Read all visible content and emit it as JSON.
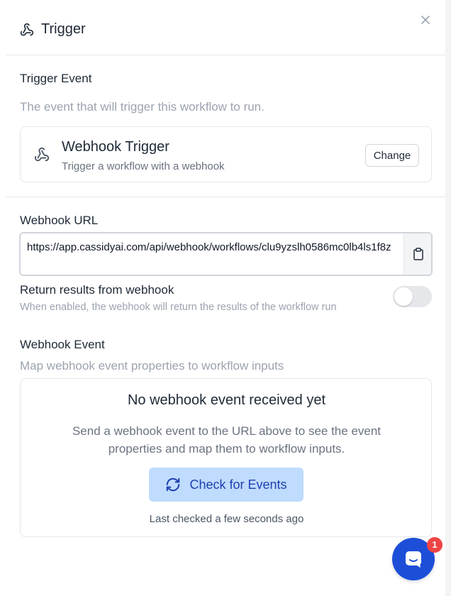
{
  "header": {
    "title": "Trigger",
    "icon": "webhook-icon",
    "close_icon": "close-icon"
  },
  "trigger_event": {
    "label": "Trigger Event",
    "description": "The event that will trigger this workflow to run.",
    "card": {
      "icon": "webhook-icon",
      "title": "Webhook Trigger",
      "subtitle": "Trigger a workflow with a webhook",
      "change_label": "Change"
    }
  },
  "webhook_url": {
    "label": "Webhook URL",
    "value": "https://app.cassidyai.com/api/webhook/workflows/clu9yzslh0586mc0lb4ls1f8z",
    "copy_icon": "clipboard-icon"
  },
  "return_results": {
    "label": "Return results from webhook",
    "description": "When enabled, the webhook will return the results of the workflow run",
    "enabled": false
  },
  "webhook_event": {
    "label": "Webhook Event",
    "description": "Map webhook event properties to workflow inputs",
    "empty_title": "No webhook event received yet",
    "empty_description": "Send a webhook event to the URL above to see the event properties and map them to workflow inputs.",
    "check_button": {
      "label": "Check for Events",
      "icon": "refresh-icon"
    },
    "last_checked": "Last checked a few seconds ago"
  },
  "chat": {
    "icon": "chat-icon",
    "badge": "1"
  },
  "colors": {
    "accent": "#1d4ed8",
    "button_bg": "#bfdbfe",
    "badge": "#ef4444"
  }
}
